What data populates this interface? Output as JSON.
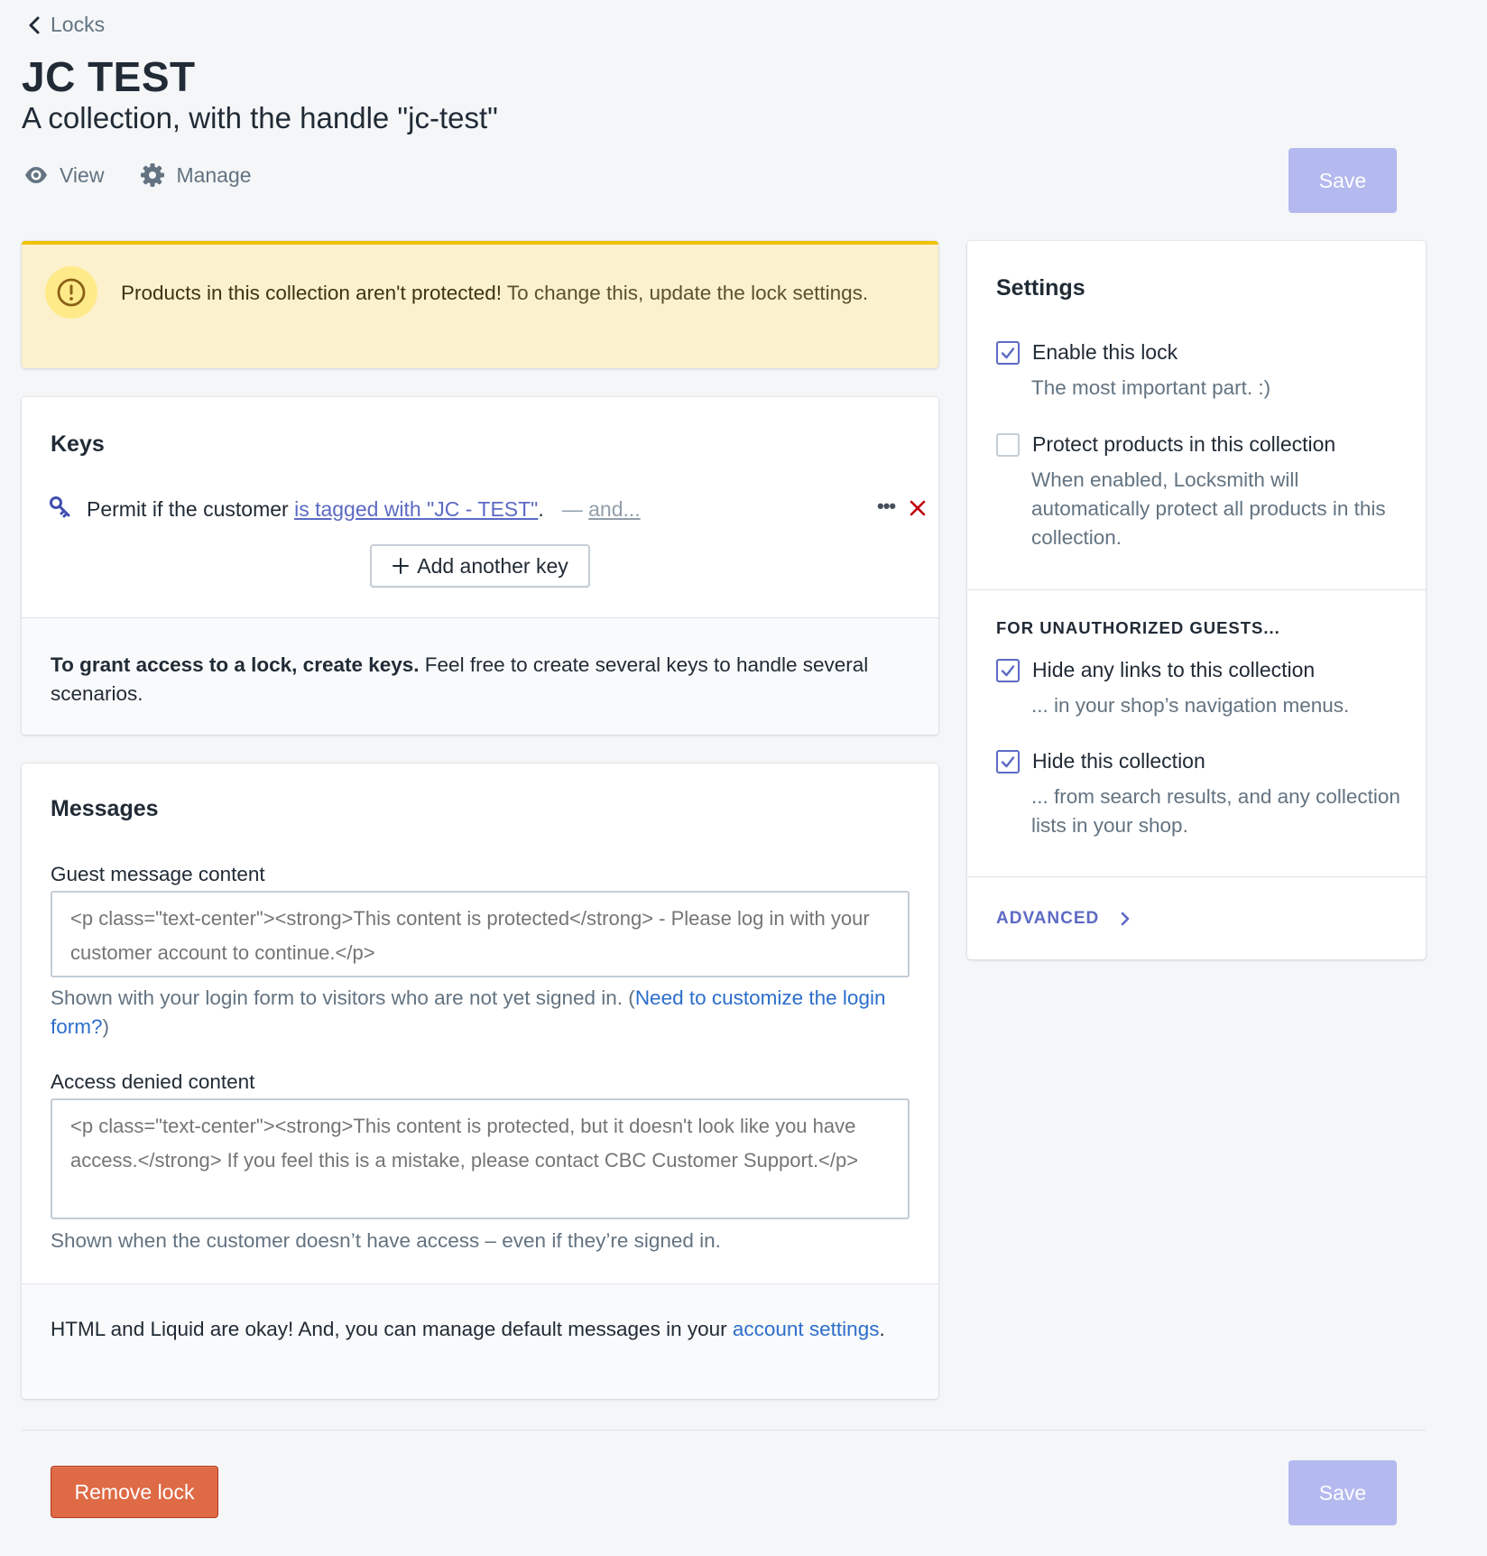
{
  "header": {
    "breadcrumb": "Locks",
    "title": "JC TEST",
    "subtitle": "A collection, with the handle \"jc-test\"",
    "actions": [
      {
        "label": "View",
        "icon": "eye-icon"
      },
      {
        "label": "Manage",
        "icon": "gear-icon"
      }
    ],
    "save_label": "Save"
  },
  "banner": {
    "icon": "alert-circle-icon",
    "strong": "Products in this collection aren't protected!",
    "text": " To change this, update the lock settings."
  },
  "keys": {
    "title": "Keys",
    "key_icon": "key-icon",
    "items": [
      {
        "prefix": "Permit if the customer ",
        "condition": "is tagged with \"JC - TEST\"",
        "suffix": ".",
        "and_dash": "— ",
        "and_label": "and...",
        "more_label": "•••"
      }
    ],
    "add_label": "Add another key",
    "footer_strong": "To grant access to a lock, create keys.",
    "footer_text": " Feel free to create several keys to handle several scenarios."
  },
  "messages": {
    "title": "Messages",
    "guest": {
      "label": "Guest message content",
      "placeholder": "<p class=\"text-center\"><strong>This content is protected</strong> - Please log in with your customer account to continue.</p>",
      "help": "Shown with your login form to visitors who are not yet signed in. (",
      "help_link": "Need to customize the login form?",
      "help_end": ")"
    },
    "denied": {
      "label": "Access denied content",
      "placeholder": "<p class=\"text-center\"><strong>This content is protected, but it doesn't look like you have access.</strong> If you feel this is a mistake, please contact CBC Customer Support.</p>",
      "help": "Shown when the customer doesn’t have access – even if they’re signed in."
    },
    "footer_text": "HTML and Liquid are okay! And, you can manage default messages in your ",
    "footer_link": "account settings",
    "footer_end": "."
  },
  "settings": {
    "title": "Settings",
    "enable": {
      "label": "Enable this lock",
      "desc": "The most important part. :)",
      "checked": true
    },
    "protect": {
      "label": "Protect products in this collection",
      "desc": "When enabled, Locksmith will automatically protect all products in this collection.",
      "checked": false
    },
    "guests_heading": "FOR UNAUTHORIZED GUESTS...",
    "hide_links": {
      "label": "Hide any links to this collection",
      "desc": "... in your shop’s navigation menus.",
      "checked": true
    },
    "hide_collection": {
      "label": "Hide this collection",
      "desc": "... from search results, and any collection lists in your shop.",
      "checked": true
    },
    "advanced_label": "ADVANCED"
  },
  "footer": {
    "remove_label": "Remove lock",
    "save_label": "Save"
  },
  "colors": {
    "background": "#f4f6f8",
    "accent": "#5c6ac4",
    "save_disabled": "#b4b9ef",
    "destructive": "#de6a46",
    "warning_bg": "#fcf1cd",
    "warning_border": "#eec200",
    "link": "#2c6ecb"
  }
}
